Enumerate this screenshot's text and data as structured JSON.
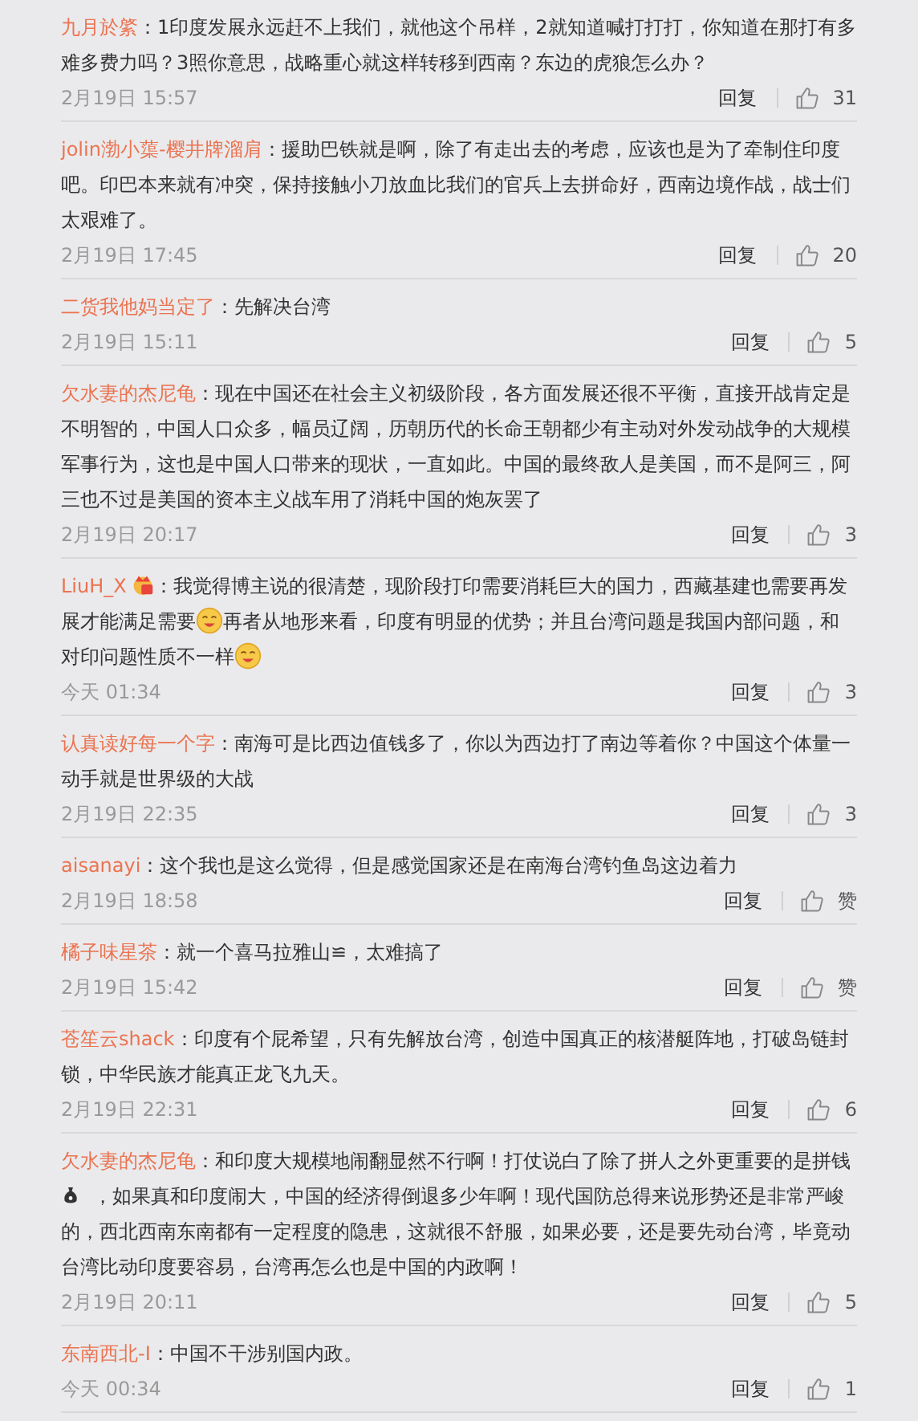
{
  "comments": [
    {
      "user": "九月於綮",
      "badge": false,
      "body": [
        {
          "kind": "text",
          "text": "：1印度发展永远赶不上我们，就他这个吊样，2就知道喊打打打，你知道在那打有多难多费力吗？3照你意思，战略重心就这样转移到西南？东边的虎狼怎么办？"
        }
      ],
      "time": "2月19日 15:57",
      "reply": "回复",
      "likes": "31"
    },
    {
      "user": "jolin渤小蕖-樱井牌溜肩",
      "badge": false,
      "body": [
        {
          "kind": "text",
          "text": "：援助巴铁就是啊，除了有走出去的考虑，应该也是为了牵制住印度吧。印巴本来就有冲突，保持接触小刀放血比我们的官兵上去拼命好，西南边境作战，战士们太艰难了。"
        }
      ],
      "time": "2月19日 17:45",
      "reply": "回复",
      "likes": "20"
    },
    {
      "user": "二货我他妈当定了",
      "badge": false,
      "body": [
        {
          "kind": "text",
          "text": "：先解决台湾"
        }
      ],
      "time": "2月19日 15:11",
      "reply": "回复",
      "likes": "5"
    },
    {
      "user": "欠水妻的杰尼龟",
      "badge": false,
      "body": [
        {
          "kind": "text",
          "text": "：现在中国还在社会主义初级阶段，各方面发展还很不平衡，直接开战肯定是不明智的，中国人口众多，幅员辽阔，历朝历代的长命王朝都少有主动对外发动战争的大规模军事行为，这也是中国人口带来的现状，一直如此。中国的最终敌人是美国，而不是阿三，阿三也不过是美国的资本主义战车用了消耗中国的炮灰罢了"
        }
      ],
      "time": "2月19日 20:17",
      "reply": "回复",
      "likes": "3"
    },
    {
      "user": "LiuH_X",
      "badge": true,
      "body": [
        {
          "kind": "text",
          "text": "：我觉得博主说的很清楚，现阶段打印需要消耗巨大的国力，西藏基建也需要再发展才能满足需要"
        },
        {
          "kind": "yum"
        },
        {
          "kind": "text",
          "text": "再者从地形来看，印度有明显的优势；并且台湾问题是我国内部问题，和对印问题性质不一样"
        },
        {
          "kind": "yum"
        }
      ],
      "time": "今天 01:34",
      "reply": "回复",
      "likes": "3"
    },
    {
      "user": "认真读好每一个字",
      "badge": false,
      "body": [
        {
          "kind": "text",
          "text": "：南海可是比西边值钱多了，你以为西边打了南边等着你？中国这个体量一动手就是世界级的大战"
        }
      ],
      "time": "2月19日 22:35",
      "reply": "回复",
      "likes": "3"
    },
    {
      "user": "aisanayi",
      "badge": false,
      "body": [
        {
          "kind": "text",
          "text": "：这个我也是这么觉得，但是感觉国家还是在南海台湾钓鱼岛这边着力"
        }
      ],
      "time": "2月19日 18:58",
      "reply": "回复",
      "likes": "赞"
    },
    {
      "user": "橘子味星茶",
      "badge": false,
      "body": [
        {
          "kind": "text",
          "text": "：就一个喜马拉雅山≌，太难搞了"
        }
      ],
      "time": "2月19日 15:42",
      "reply": "回复",
      "likes": "赞"
    },
    {
      "user": "苍笙云shack",
      "badge": false,
      "body": [
        {
          "kind": "text",
          "text": "：印度有个屁希望，只有先解放台湾，创造中国真正的核潜艇阵地，打破岛链封锁，中华民族才能真正龙飞九天。"
        }
      ],
      "time": "2月19日 22:31",
      "reply": "回复",
      "likes": "6"
    },
    {
      "user": "欠水妻的杰尼龟",
      "badge": false,
      "body": [
        {
          "kind": "text",
          "text": "：和印度大规模地闹翻显然不行啊！打仗说白了除了拼人之外更重要的是拼钱"
        },
        {
          "kind": "moneybag"
        },
        {
          "kind": "text",
          "text": "，如果真和印度闹大，中国的经济得倒退多少年啊！现代国防总得来说形势还是非常严峻的，西北西南东南都有一定程度的隐患，这就很不舒服，如果必要，还是要先动台湾，毕竟动台湾比动印度要容易，台湾再怎么也是中国的内政啊！"
        }
      ],
      "time": "2月19日 20:11",
      "reply": "回复",
      "likes": "5"
    },
    {
      "user": "东南西北-I",
      "badge": false,
      "body": [
        {
          "kind": "text",
          "text": "：中国不干涉别国内政。"
        }
      ],
      "time": "今天 00:34",
      "reply": "回复",
      "likes": "1"
    }
  ]
}
